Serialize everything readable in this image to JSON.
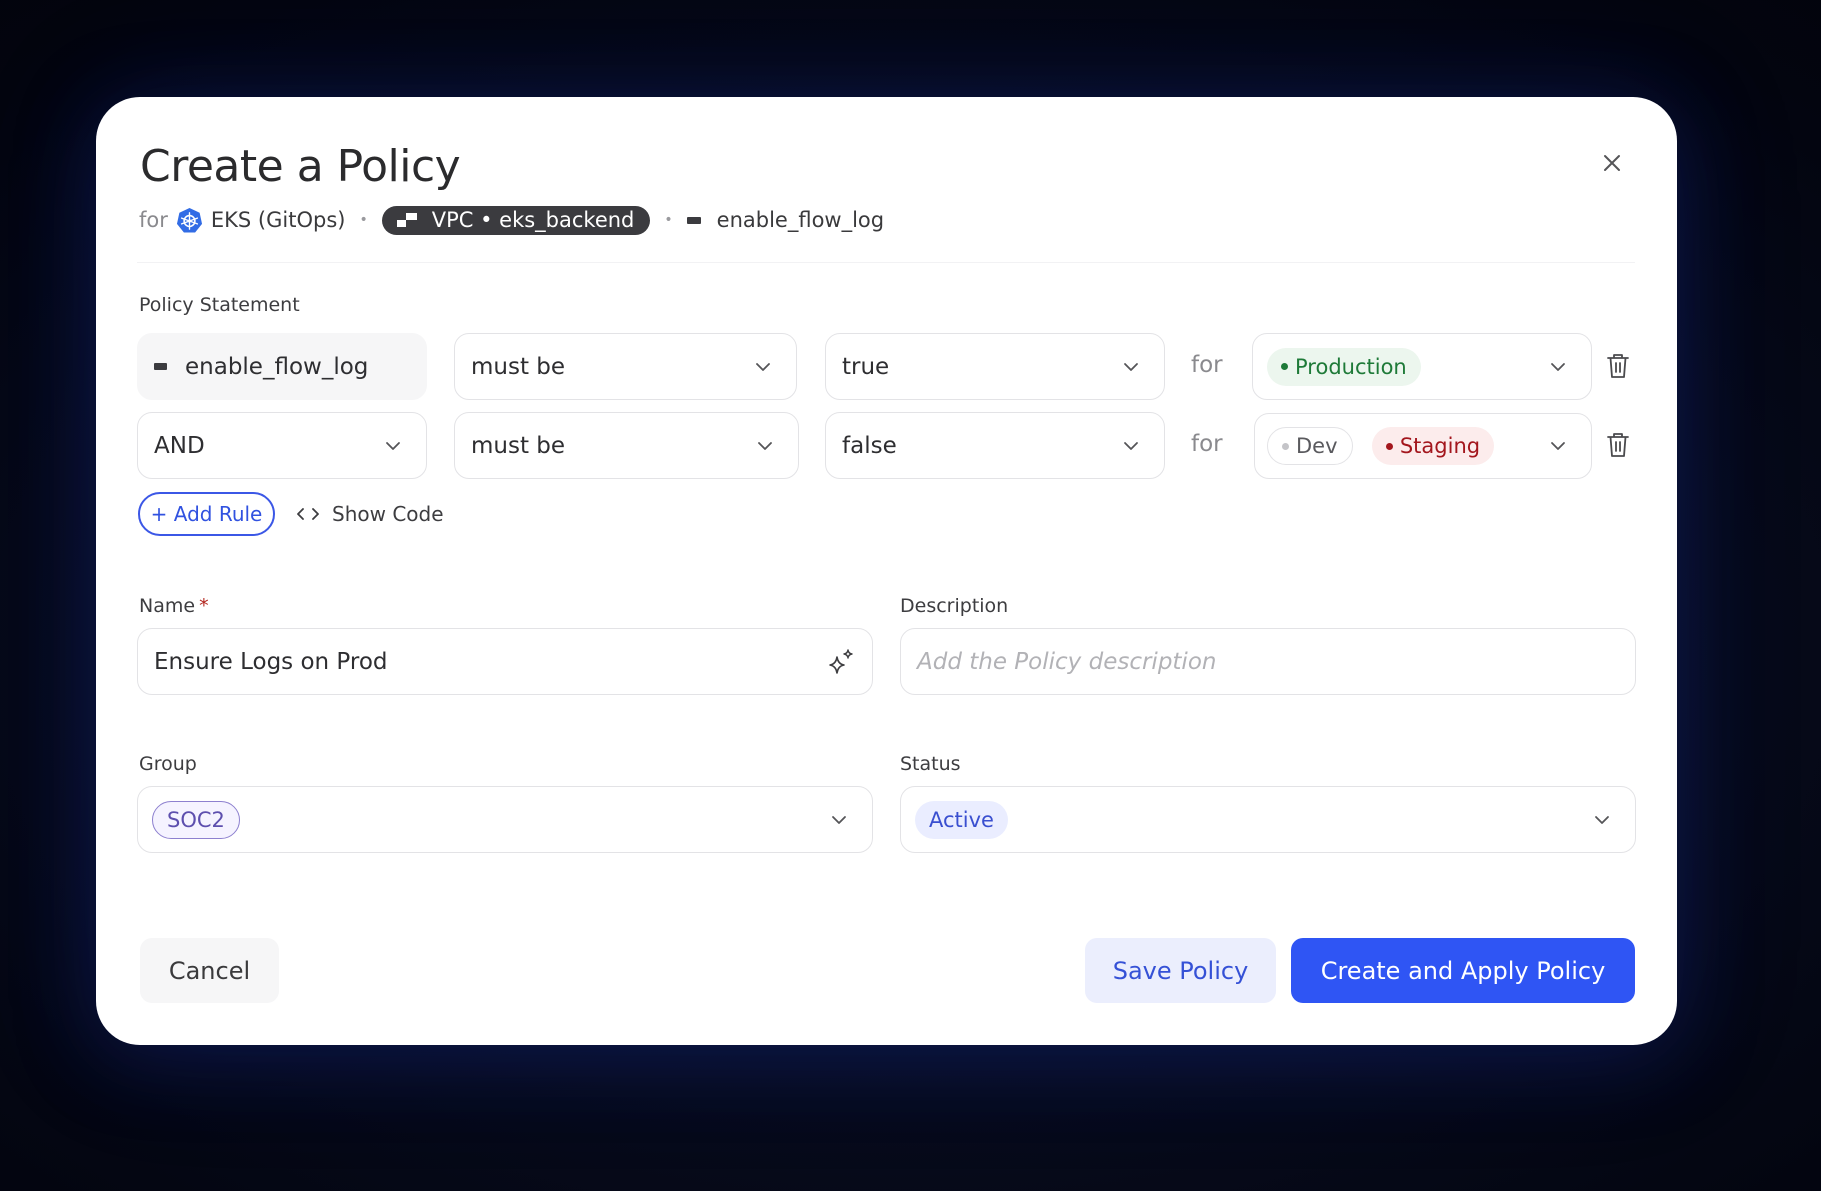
{
  "dialog": {
    "title": "Create a Policy",
    "subtitle": {
      "prefix": "for",
      "platform": {
        "icon": "kubernetes-icon",
        "label": "EKS (GitOps)"
      },
      "resource": {
        "icon": "vpc-icon",
        "label": "VPC • eks_backend"
      },
      "attribute": {
        "icon": "attribute-icon",
        "label": "enable_flow_log"
      },
      "separator": "•"
    },
    "close_icon": "close-icon"
  },
  "policy_statement": {
    "label": "Policy Statement",
    "rules": [
      {
        "subject": "enable_flow_log",
        "subject_readonly": true,
        "operator": "must be",
        "value": "true",
        "for_label": "for",
        "environments": [
          {
            "label": "Production",
            "color": "#1e7a38",
            "style": "green"
          }
        ]
      },
      {
        "subject": "AND",
        "subject_readonly": false,
        "operator": "must be",
        "value": "false",
        "for_label": "for",
        "environments": [
          {
            "label": "Dev",
            "color": "#c4c4c8",
            "style": "grey"
          },
          {
            "label": "Staging",
            "color": "#a3161d",
            "style": "red"
          }
        ]
      }
    ],
    "add_rule_label": "+ Add Rule",
    "show_code_label": "Show Code"
  },
  "form": {
    "name": {
      "label": "Name",
      "required_mark": "*",
      "value": "Ensure Logs on Prod"
    },
    "description": {
      "label": "Description",
      "value": "",
      "placeholder": "Add the Policy description"
    },
    "group": {
      "label": "Group",
      "value": "SOC2"
    },
    "status": {
      "label": "Status",
      "value": "Active"
    }
  },
  "footer": {
    "cancel_label": "Cancel",
    "save_label": "Save Policy",
    "create_label": "Create and Apply Policy"
  },
  "colors": {
    "primary": "#2f55f4",
    "primary_soft": "#ebeefd",
    "production": "#1e7a38",
    "staging": "#a3161d",
    "group_tag": "#5d4fae",
    "status_tag": "#3a4fd0"
  }
}
